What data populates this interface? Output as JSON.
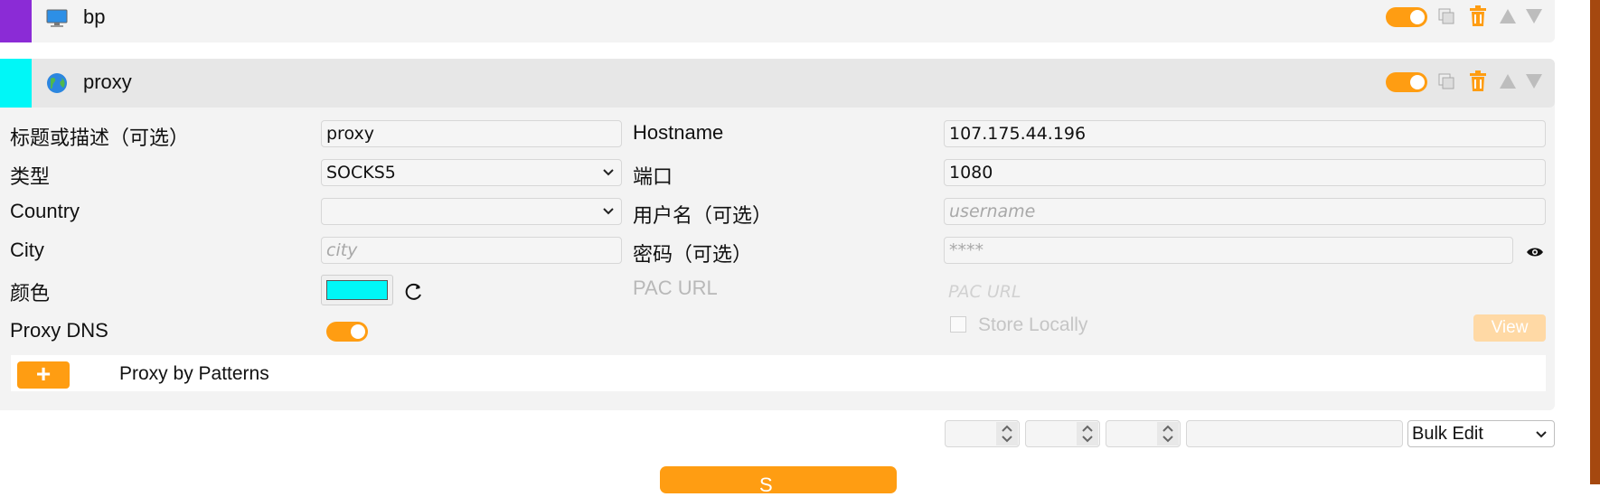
{
  "rows": [
    {
      "title": "bp",
      "strip_color": "#8b2bd6",
      "icon": "desktop-icon",
      "enabled": true
    },
    {
      "title": "proxy",
      "strip_color": "#00f7f7",
      "icon": "globe-icon",
      "enabled": true
    }
  ],
  "form": {
    "title_label": "标题或描述（可选）",
    "title_value": "proxy",
    "type_label": "类型",
    "type_value": "SOCKS5",
    "country_label": "Country",
    "country_value": "",
    "city_label": "City",
    "city_placeholder": "city",
    "color_label": "颜色",
    "color_value": "#00f7f7",
    "proxy_dns_label": "Proxy DNS",
    "proxy_dns_enabled": true,
    "hostname_label": "Hostname",
    "hostname_value": "107.175.44.196",
    "port_label": "端口",
    "port_value": "1080",
    "username_label": "用户名（可选）",
    "username_placeholder": "username",
    "password_label": "密码（可选）",
    "password_placeholder": "****",
    "pac_label": "PAC URL",
    "pac_placeholder": "PAC URL",
    "store_locally_label": "Store Locally",
    "view_button": "View"
  },
  "patterns": {
    "add_button": "+",
    "label": "Proxy by Patterns"
  },
  "bulk": {
    "select_value": "Bulk Edit"
  },
  "save_button": "S",
  "accent": "#ff9d12"
}
